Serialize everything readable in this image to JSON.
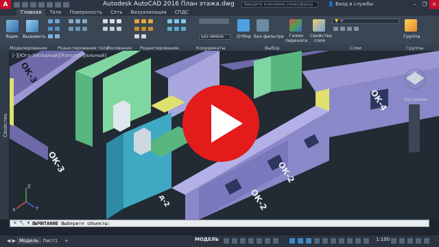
{
  "app": {
    "logo": "A",
    "title": "Autodesk AutoCAD 2016     План этажа.dwg",
    "search_placeholder": "Введите ключевое слово/фразу",
    "login": "Вход в службы",
    "window_controls": [
      "minimize-icon",
      "restore-icon",
      "close-icon"
    ]
  },
  "tabs": [
    {
      "label": "Главная",
      "active": true
    },
    {
      "label": "Тело"
    },
    {
      "label": "Поверхность"
    },
    {
      "label": "Сеть"
    },
    {
      "label": "Визуализация"
    },
    {
      "label": "СПДС"
    }
  ],
  "ribbon": {
    "buttons": {
      "box": "Ящик",
      "extrude": "Выдавить",
      "visual_style": "Без имени",
      "selection": "Отбор",
      "no_filter": "Без фильтра",
      "gizmo": "Гизмо переноса",
      "layer_props": "Свойства слоя",
      "group": "Группа",
      "layer_value": "0"
    },
    "panels": [
      "Моделирование",
      "Редактирование тела",
      "Рисование",
      "Редактирование",
      "Координаты",
      "Выбор",
      "Слои",
      "Группы"
    ]
  },
  "viewport": {
    "label": "[-][Юго-Западный][Концептуальный]",
    "side_palette": "Свойства",
    "viewcube_label": "Без имени",
    "background": "#222a33",
    "wall_labels": [
      "ОК-2",
      "ОК-3",
      "ОК-4",
      "ОК-3",
      "д-2"
    ]
  },
  "command": {
    "prefix": "ВЫЧИТАНИЕ",
    "text": " Выберите объекты:"
  },
  "statusbar": {
    "layout_tabs": [
      "Модель",
      "Лист1"
    ],
    "plus": "+",
    "model": "МОДЕЛЬ",
    "scale": "1:100"
  },
  "colors": {
    "accent": "#e31b1b",
    "wall_purple": "#8a88c8",
    "wall_green": "#7fd6a0",
    "wall_yellow": "#e0e070",
    "wall_teal": "#3fa9c4"
  }
}
